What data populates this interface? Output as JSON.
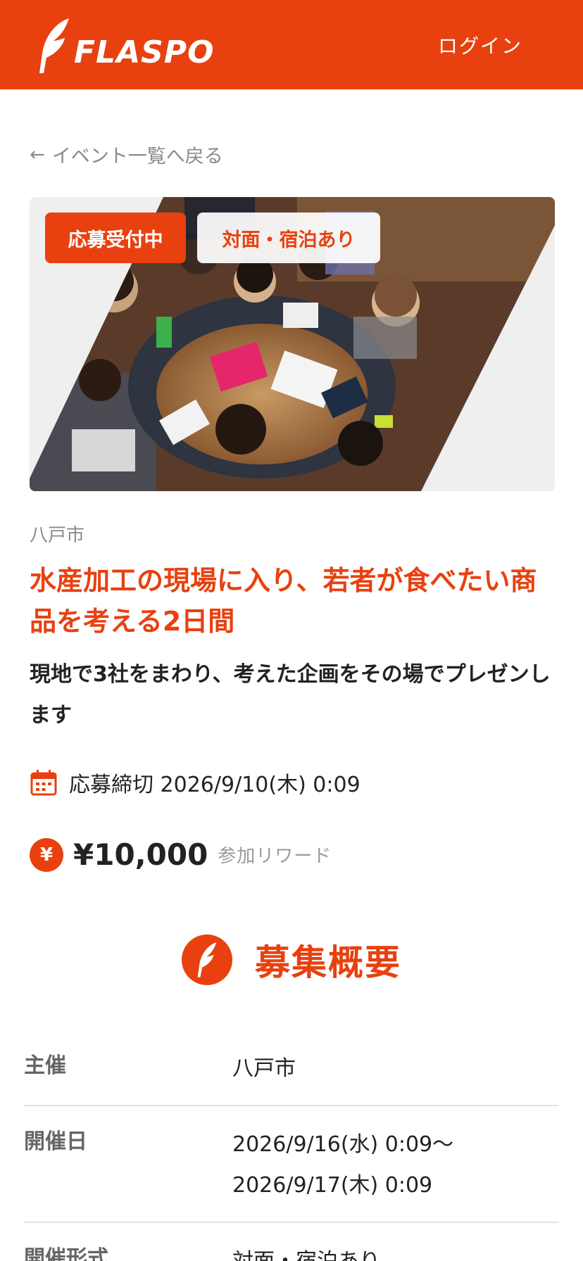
{
  "header": {
    "logo_text": "FLASPO",
    "login_label": "ログイン",
    "brand_color": "#e8410f"
  },
  "back_link": {
    "label": "イベント一覧へ戻る",
    "icon": "arrow-left-icon"
  },
  "hero": {
    "badges": [
      "応募受付中",
      "対面・宿泊あり"
    ]
  },
  "event": {
    "city": "八戸市",
    "title": "水産加工の現場に入り、若者が食べたい商品を考える2日間",
    "subtitle": "現地で3社をまわり、考えた企画をその場でプレゼンします",
    "deadline_label": "応募締切 2026/9/10(木) 0:09",
    "reward_amount": "¥10,000",
    "reward_label": "参加リワード",
    "reward_icon_glyph": "¥"
  },
  "overview": {
    "title": "募集概要",
    "rows": [
      {
        "label": "主催",
        "value_lines": [
          "八戸市"
        ]
      },
      {
        "label": "開催日",
        "value_lines": [
          "2026/9/16(水) 0:09〜",
          "2026/9/17(木) 0:09"
        ]
      },
      {
        "label": "開催形式",
        "value_lines": [
          "対面・宿泊あり"
        ]
      }
    ]
  }
}
